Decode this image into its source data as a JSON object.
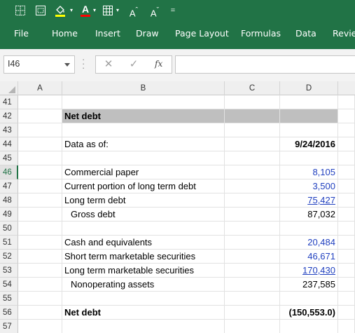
{
  "ribbon": {
    "quick_access": {
      "font_grow_label": "A",
      "font_shrink_label": "A",
      "font_grow_glyph": "ˆ",
      "font_shrink_glyph": "ˇ",
      "customize_label": "="
    },
    "tabs": [
      "File",
      "Home",
      "Insert",
      "Draw",
      "Page Layout",
      "Formulas",
      "Data",
      "Review"
    ],
    "colors": {
      "ribbon_bg": "#217346",
      "fill_color": "#ffff00",
      "font_color": "#ff0000"
    }
  },
  "formula_bar": {
    "name_box": "I46",
    "fx_label": "fx",
    "cancel_label": "✕",
    "enter_label": "✓",
    "formula": ""
  },
  "sheet": {
    "columns": [
      "A",
      "B",
      "C",
      "D"
    ],
    "active_row": "46",
    "rows": [
      {
        "num": "41",
        "b": "",
        "d": ""
      },
      {
        "num": "42",
        "b": "Net debt",
        "d": ""
      },
      {
        "num": "43",
        "b": "",
        "d": ""
      },
      {
        "num": "44",
        "b": "Data as of:",
        "d": "9/24/2016"
      },
      {
        "num": "45",
        "b": "",
        "d": ""
      },
      {
        "num": "46",
        "b": "Commercial paper",
        "d": "8,105"
      },
      {
        "num": "47",
        "b": "Current portion of long term debt",
        "d": "3,500"
      },
      {
        "num": "48",
        "b": "Long term debt",
        "d": "75,427"
      },
      {
        "num": "49",
        "b": "Gross debt",
        "d": "87,032"
      },
      {
        "num": "50",
        "b": "",
        "d": ""
      },
      {
        "num": "51",
        "b": "Cash and equivalents",
        "d": "20,484"
      },
      {
        "num": "52",
        "b": "Short term marketable securities",
        "d": "46,671"
      },
      {
        "num": "53",
        "b": "Long term marketable securities",
        "d": "170,430"
      },
      {
        "num": "54",
        "b": "Nonoperating assets",
        "d": "237,585"
      },
      {
        "num": "55",
        "b": "",
        "d": ""
      },
      {
        "num": "56",
        "b": "Net debt",
        "d": "(150,553.0)"
      },
      {
        "num": "57",
        "b": "",
        "d": ""
      }
    ]
  }
}
